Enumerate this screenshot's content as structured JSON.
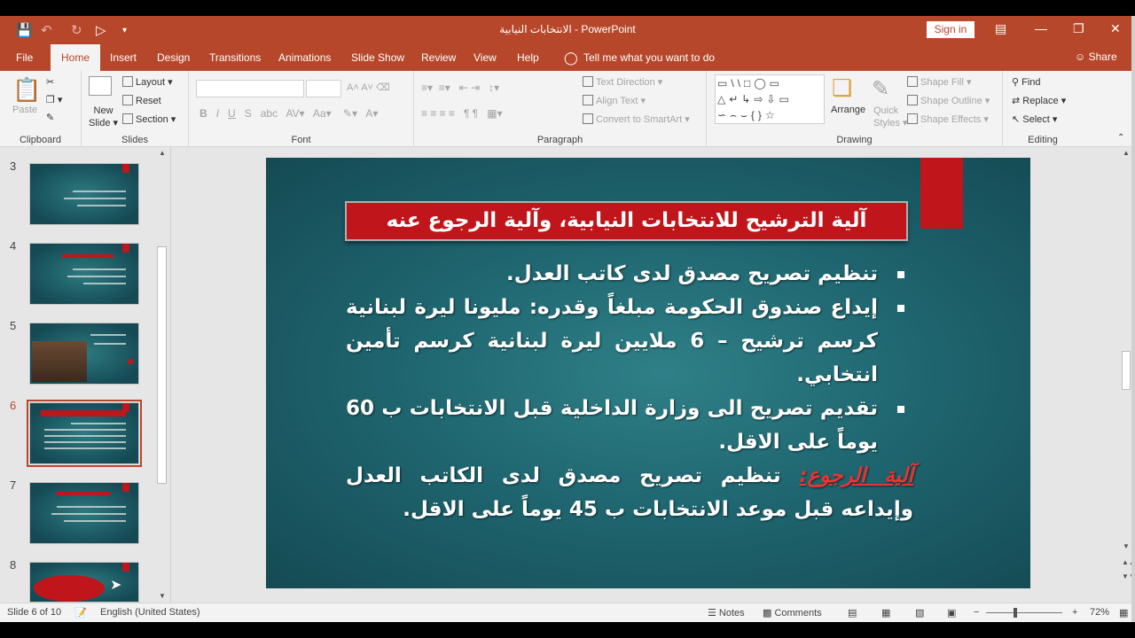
{
  "titlebar": {
    "document_title": "الانتخابات النيابية - PowerPoint",
    "sign_in": "Sign in",
    "icons": [
      "save-icon",
      "undo-icon",
      "redo-icon",
      "start-from-beginning-icon",
      "customize-qat-icon"
    ]
  },
  "tabs": [
    "File",
    "Home",
    "Insert",
    "Design",
    "Transitions",
    "Animations",
    "Slide Show",
    "Review",
    "View",
    "Help"
  ],
  "active_tab": "Home",
  "tell_me": "Tell me what you want to do",
  "share": "Share",
  "ribbon": {
    "clipboard": {
      "label": "Clipboard",
      "paste": "Paste"
    },
    "slides": {
      "label": "Slides",
      "new_slide": "New Slide",
      "new_slide_l1": "New",
      "new_slide_l2": "Slide",
      "layout": "Layout",
      "reset": "Reset",
      "section": "Section"
    },
    "font": {
      "label": "Font"
    },
    "paragraph": {
      "label": "Paragraph",
      "text_direction": "Text Direction",
      "align_text": "Align Text",
      "convert_smartart": "Convert to SmartArt"
    },
    "drawing": {
      "label": "Drawing",
      "arrange": "Arrange",
      "quick_styles": "Quick Styles",
      "quick_styles_l1": "Quick",
      "quick_styles_l2": "Styles",
      "shape_fill": "Shape Fill",
      "shape_outline": "Shape Outline",
      "shape_effects": "Shape Effects"
    },
    "editing": {
      "label": "Editing",
      "find": "Find",
      "replace": "Replace",
      "select": "Select"
    }
  },
  "thumbnails": [
    {
      "num": "3"
    },
    {
      "num": "4"
    },
    {
      "num": "5"
    },
    {
      "num": "6"
    },
    {
      "num": "7"
    },
    {
      "num": "8"
    }
  ],
  "active_slide": "6",
  "slide": {
    "title": "آلية الترشيح للانتخابات النيابية، وآلية الرجوع عنه",
    "bullets": [
      "تنظيم تصريح مصدق لدى كاتب العدل.",
      "إيداع صندوق الحكومة مبلغاً وقدره: مليونا ليرة لبنانية كرسم ترشيح – 6 ملايين ليرة لبنانية كرسم تأمين انتخابي.",
      "تقديم تصريح الى وزارة الداخلية قبل الانتخابات ب 60 يوماً على الاقل."
    ],
    "withdrawal_label": "آلية الرجوع:",
    "withdrawal_text": " تنظيم تصريح مصدق لدى الكاتب العدل وإيداعه قبل موعد الانتخابات ب 45 يوماً على الاقل."
  },
  "statusbar": {
    "slide_of": "Slide 6 of 10",
    "language": "English (United States)",
    "notes": "Notes",
    "comments": "Comments",
    "zoom": "72%"
  }
}
